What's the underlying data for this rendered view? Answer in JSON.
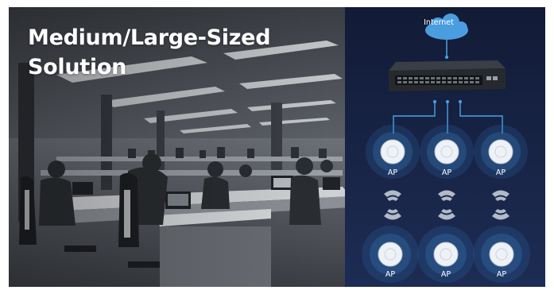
{
  "title": {
    "line1": "Medium/Large-Sized",
    "line2": "Solution"
  },
  "network": {
    "cloud_label": "Internet",
    "switch_icon": "network-switch-icon",
    "ap_icon": "ceiling-access-point-icon",
    "ap_labels": [
      "AP",
      "AP",
      "AP",
      "AP",
      "AP",
      "AP"
    ]
  },
  "colors": {
    "panel_top": "#121b36",
    "panel_bottom": "#1d2c54",
    "accent_blue": "#4aa3e6",
    "cloud": "#4a9ee0",
    "text": "#ffffff"
  }
}
